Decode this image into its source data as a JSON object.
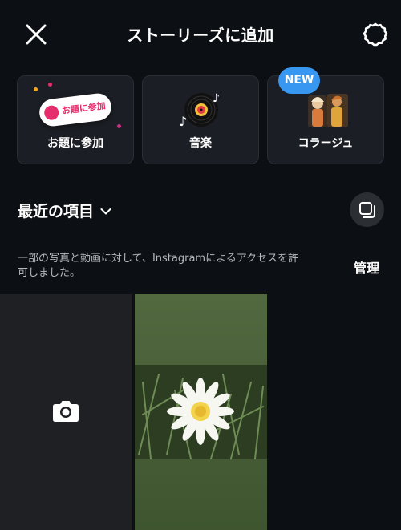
{
  "header": {
    "title": "ストーリーズに追加",
    "close_icon": "close-icon",
    "settings_icon": "gear-icon"
  },
  "cards": [
    {
      "label": "お題に参加",
      "sticker_text": "お題に参加"
    },
    {
      "label": "音楽"
    },
    {
      "label": "コラージュ",
      "badge": "NEW"
    }
  ],
  "recent": {
    "title": "最近の項目",
    "dropdown_icon": "chevron-down-icon",
    "multi_select_icon": "multi-select-icon"
  },
  "permission": {
    "message": "一部の写真と動画に対して、Instagramによるアクセスを許可しました。",
    "manage_label": "管理"
  },
  "grid": {
    "camera_icon": "camera-icon",
    "photos": [
      {
        "subject": "white daisy flower"
      }
    ]
  },
  "colors": {
    "background": "#0c0f14",
    "card": "#1b1e24",
    "accent_blue": "#3897f0",
    "topic_pink": "#e62d6d",
    "muted_text": "#b5b8bd"
  }
}
